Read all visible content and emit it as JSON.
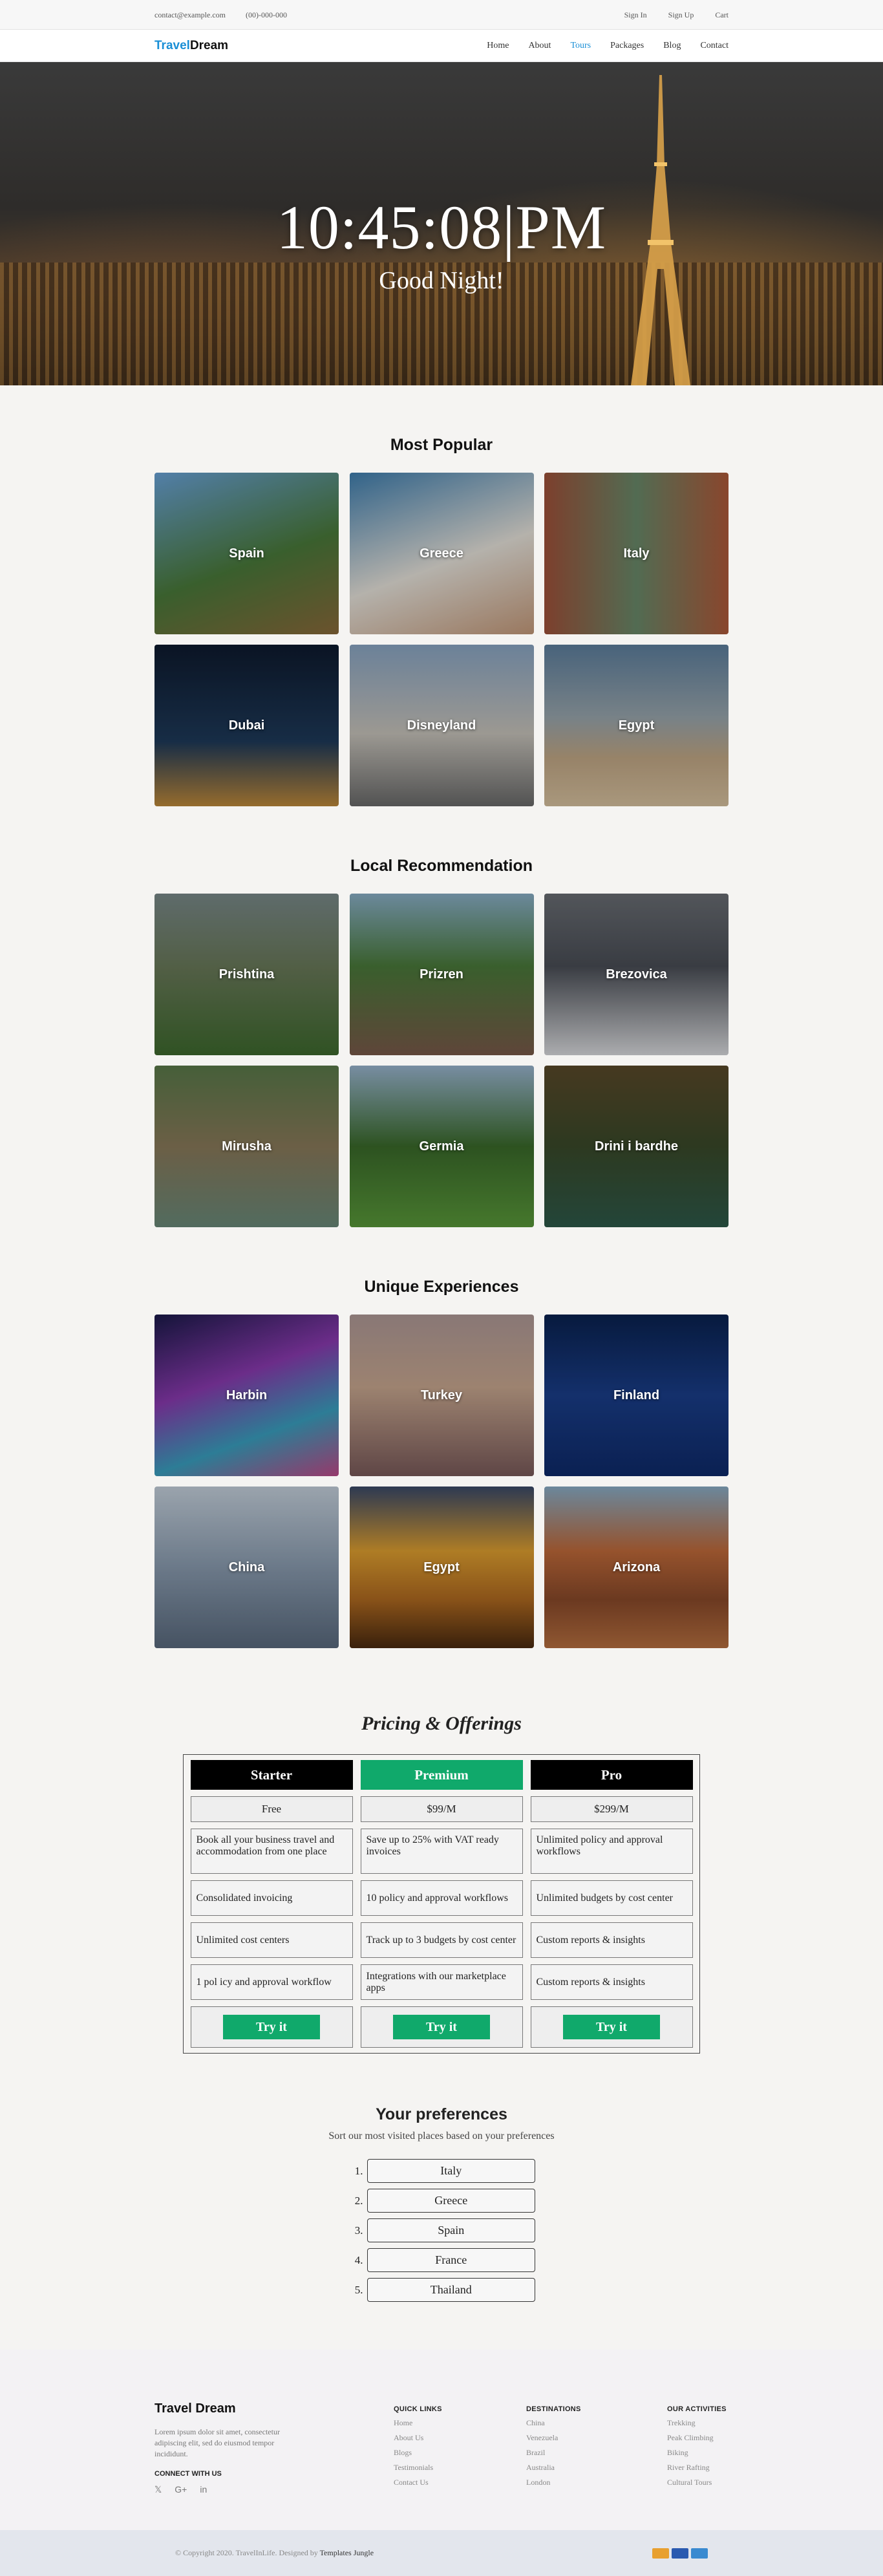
{
  "topbar": {
    "email": "contact@example.com",
    "phone": "(00)-000-000",
    "signin": "Sign In",
    "signup": "Sign Up",
    "cart": "Cart"
  },
  "nav": {
    "logo_a": "Travel",
    "logo_b": "Dream",
    "items": [
      "Home",
      "About",
      "Tours",
      "Packages",
      "Blog",
      "Contact"
    ],
    "active": "Tours"
  },
  "hero": {
    "clock": "10:45:08|PM",
    "greeting": "Good Night!"
  },
  "popular": {
    "title": "Most Popular",
    "items": [
      "Spain",
      "Greece",
      "Italy",
      "Dubai",
      "Disneyland",
      "Egypt"
    ]
  },
  "local": {
    "title": "Local Recommendation",
    "items": [
      "Prishtina",
      "Prizren",
      "Brezovica",
      "Mirusha",
      "Germia",
      "Drini i bardhe"
    ]
  },
  "unique": {
    "title": "Unique Experiences",
    "items": [
      "Harbin",
      "Turkey",
      "Finland",
      "China",
      "Egypt",
      "Arizona"
    ]
  },
  "pricing": {
    "title": "Pricing & Offerings",
    "plans": [
      {
        "name": "Starter",
        "price": "Free",
        "features": [
          "Book all your business travel and accommodation from one place",
          "Consolidated invoicing",
          "Unlimited cost centers",
          "1 pol icy and approval workflow"
        ],
        "cta": "Try it"
      },
      {
        "name": "Premium",
        "price": "$99/M",
        "features": [
          "Save up to 25% with VAT ready invoices",
          "10 policy and approval workflows",
          "Track up to 3 budgets by cost center",
          "Integrations with our marketplace apps"
        ],
        "cta": "Try it"
      },
      {
        "name": "Pro",
        "price": "$299/M",
        "features": [
          "Unlimited policy and approval workflows",
          "Unlimited budgets by cost center",
          "Custom reports & insights",
          "Custom reports & insights"
        ],
        "cta": "Try it"
      }
    ]
  },
  "preferences": {
    "title": "Your preferences",
    "subtitle": "Sort our most visited places based on your preferences",
    "items": [
      "Italy",
      "Greece",
      "Spain",
      "France",
      "Thailand"
    ]
  },
  "footer": {
    "brand": "Travel Dream",
    "desc": "Lorem ipsum dolor sit amet, consectetur adipiscing elit, sed do eiusmod tempor incididunt.",
    "connect": "CONNECT WITH US",
    "quick": {
      "title": "QUICK LINKS",
      "links": [
        "Home",
        "About Us",
        "Blogs",
        "Testimonials",
        "Contact Us"
      ]
    },
    "dest": {
      "title": "DESTINATIONS",
      "links": [
        "China",
        "Venezuela",
        "Brazil",
        "Australia",
        "London"
      ]
    },
    "acts": {
      "title": "OUR ACTIVITIES",
      "links": [
        "Trekking",
        "Peak Climbing",
        "Biking",
        "River Rafting",
        "Cultural Tours"
      ]
    },
    "copyright": "© Copyright 2020. TravelInLife. Designed by",
    "designer": "Templates Jungle"
  },
  "colors": {
    "accent": "#1a8fd6",
    "green": "#10a96b"
  }
}
